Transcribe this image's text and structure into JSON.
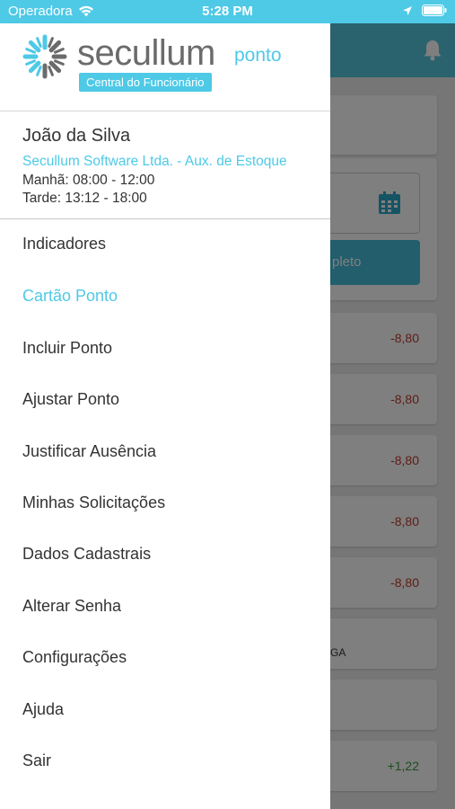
{
  "status_bar": {
    "carrier": "Operadora",
    "time": "5:28 PM"
  },
  "brand": {
    "name": "secullum",
    "suffix": "ponto",
    "tagline": "Central do Funcionário"
  },
  "user": {
    "name": "João da Silva",
    "company": "Secullum Software Ltda. - Aux. de Estoque",
    "shift_morning": "Manhã: 08:00 - 12:00",
    "shift_afternoon": "Tarde: 13:12 - 18:00"
  },
  "menu": {
    "items": [
      {
        "label": "Indicadores",
        "active": false
      },
      {
        "label": "Cartão Ponto",
        "active": true
      },
      {
        "label": "Incluir Ponto",
        "active": false
      },
      {
        "label": "Ajustar Ponto",
        "active": false
      },
      {
        "label": "Justificar Ausência",
        "active": false
      },
      {
        "label": "Minhas Solicitações",
        "active": false
      },
      {
        "label": "Dados Cadastrais",
        "active": false
      },
      {
        "label": "Alterar Senha",
        "active": false
      },
      {
        "label": "Configurações",
        "active": false
      },
      {
        "label": "Ajuda",
        "active": false
      },
      {
        "label": "Sair",
        "active": false
      }
    ]
  },
  "background": {
    "button_label_fragment": "pleto",
    "rows": [
      {
        "value": "-8,80",
        "color": "#c0392b"
      },
      {
        "value": "-8,80",
        "color": "#c0392b"
      },
      {
        "value": "-8,80",
        "color": "#c0392b"
      },
      {
        "value": "-8,80",
        "color": "#c0392b"
      },
      {
        "value": "-8,80",
        "color": "#c0392b"
      },
      {
        "text": "GA"
      },
      {
        "value": ""
      },
      {
        "value": "+1,22",
        "color": "#3b9a3b"
      }
    ]
  },
  "colors": {
    "accent": "#4ec9e6",
    "text": "#333333",
    "brand_gray": "#6b6b6b"
  },
  "icons": [
    "wifi-icon",
    "location-arrow-icon",
    "battery-icon",
    "bell-icon",
    "calendar-icon",
    "secullum-logo-icon"
  ]
}
